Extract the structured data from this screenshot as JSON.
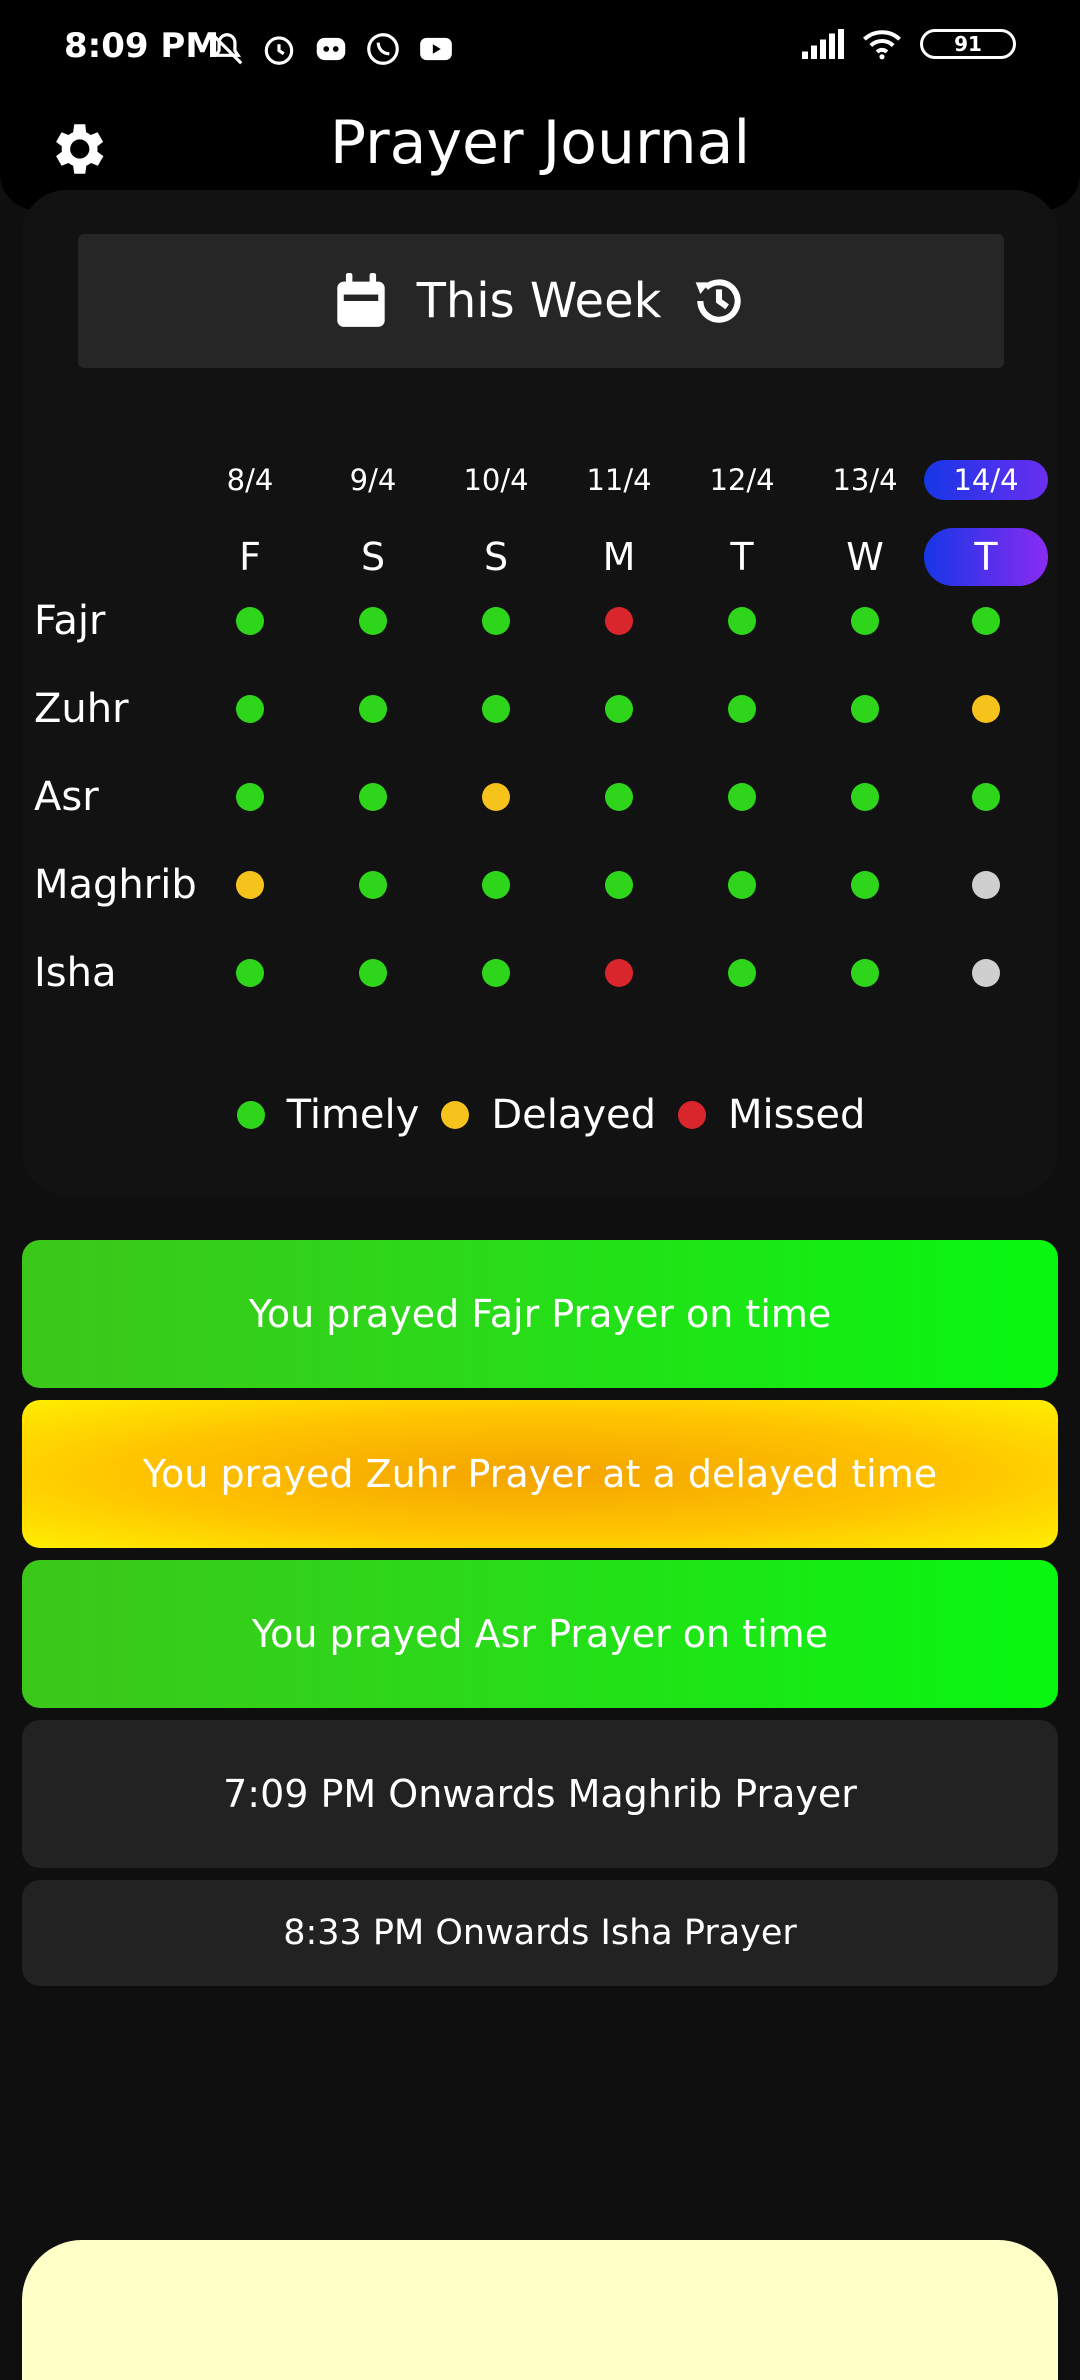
{
  "status_bar": {
    "time": "8:09 PM",
    "icons": [
      "mute-icon",
      "alarm-icon",
      "discord-icon",
      "whatsapp-icon",
      "youtube-icon"
    ],
    "battery": "91"
  },
  "app": {
    "title": "Prayer Journal"
  },
  "week": {
    "label": "This Week"
  },
  "dates": [
    "8/4",
    "9/4",
    "10/4",
    "11/4",
    "12/4",
    "13/4",
    "14/4"
  ],
  "days": [
    "F",
    "S",
    "S",
    "M",
    "T",
    "W",
    "T"
  ],
  "prayers": [
    "Fajr",
    "Zuhr",
    "Asr",
    "Maghrib",
    "Isha"
  ],
  "status_grid": [
    [
      "timely",
      "timely",
      "timely",
      "missed",
      "timely",
      "timely",
      "timely"
    ],
    [
      "timely",
      "timely",
      "timely",
      "timely",
      "timely",
      "timely",
      "delayed"
    ],
    [
      "timely",
      "timely",
      "delayed",
      "timely",
      "timely",
      "timely",
      "timely"
    ],
    [
      "delayed",
      "timely",
      "timely",
      "timely",
      "timely",
      "timely",
      "pending"
    ],
    [
      "timely",
      "timely",
      "timely",
      "missed",
      "timely",
      "timely",
      "pending"
    ]
  ],
  "legend": {
    "timely": "Timely",
    "delayed": "Delayed",
    "missed": "Missed"
  },
  "colors": {
    "timely": "#2ed51a",
    "delayed": "#f6c21c",
    "missed": "#d9262c",
    "pending": "#cfcfcf"
  },
  "cards": [
    {
      "text": "You prayed Fajr Prayer on time",
      "style": "green"
    },
    {
      "text": "You prayed Zuhr Prayer at a delayed time",
      "style": "yellow"
    },
    {
      "text": "You prayed Asr Prayer on time",
      "style": "green"
    },
    {
      "text": "7:09 PM Onwards Maghrib Prayer",
      "style": "dark"
    },
    {
      "text": "8:33 PM Onwards Isha Prayer",
      "style": "dark"
    }
  ]
}
